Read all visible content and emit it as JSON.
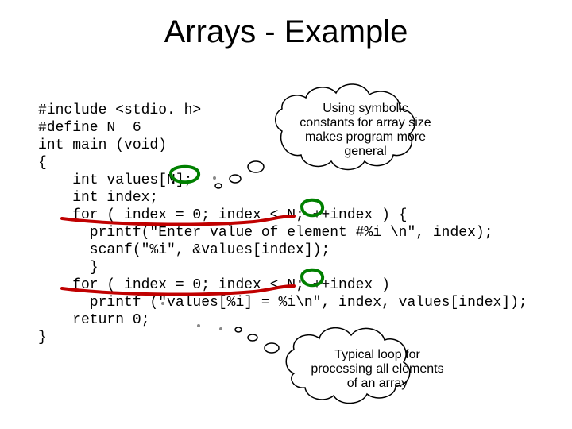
{
  "title": "Arrays - Example",
  "code": "#include <stdio. h>\n#define N  6\nint main (void)\n{\n    int values[N];\n    int index;\n    for ( index = 0; index < N; ++index ) {\n      printf(\"Enter value of element #%i \\n\", index);\n      scanf(\"%i\", &values[index]);\n      }\n    for ( index = 0; index < N; ++index )\n      printf (\"values[%i] = %i\\n\", index, values[index]);\n    return 0;\n}",
  "callout1": "Using symbolic constants for array size makes program more general",
  "callout2": "Typical loop for processing all elements of an array"
}
